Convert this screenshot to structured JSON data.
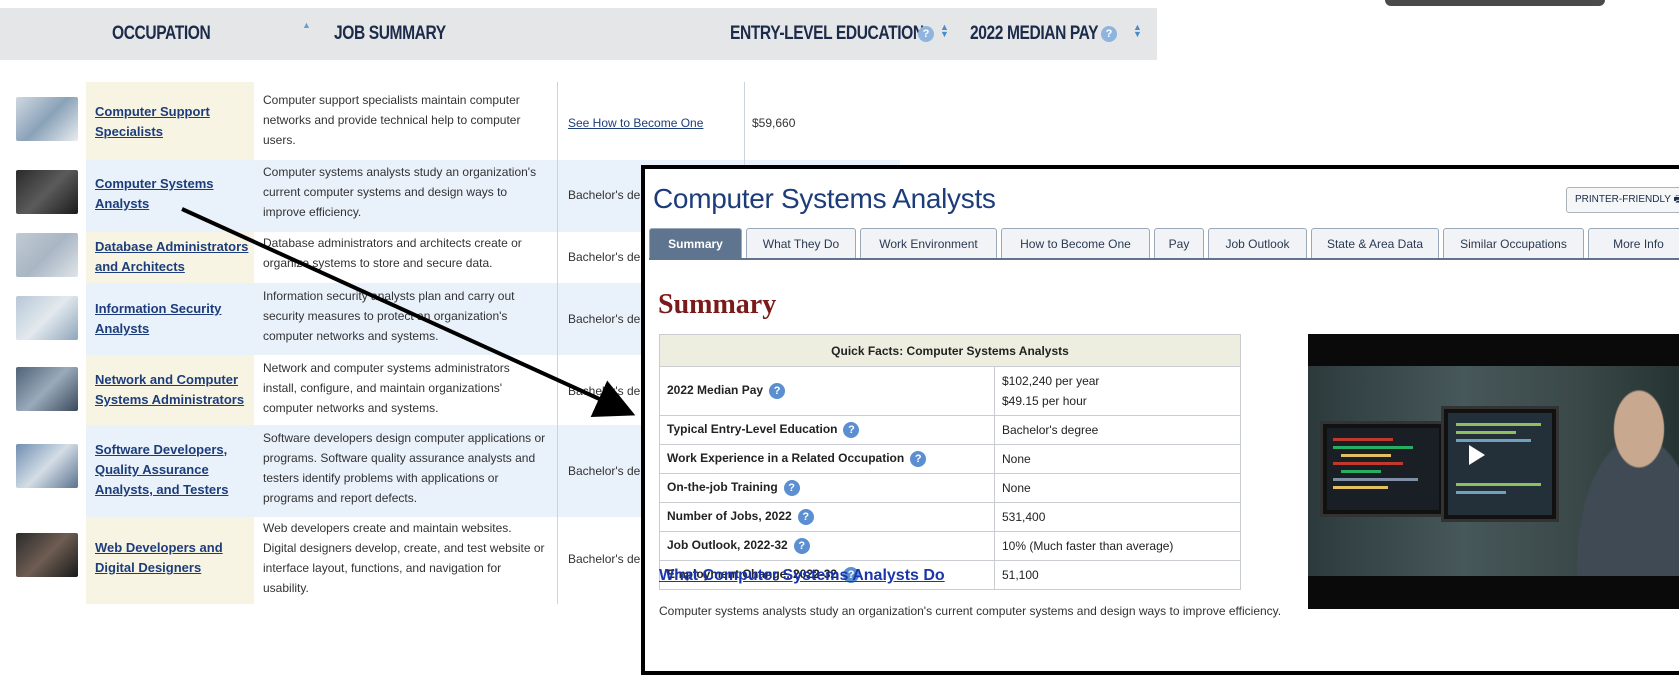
{
  "table": {
    "headers": {
      "occupation": "OCCUPATION",
      "job_summary": "JOB SUMMARY",
      "entry_level_education": "ENTRY-LEVEL EDUCATION",
      "median_pay": "2022 MEDIAN PAY"
    },
    "rows": [
      {
        "occupation": [
          "Computer Support",
          "Specialists"
        ],
        "summary": [
          "Computer support specialists maintain computer",
          "networks and provide technical help to computer",
          "users."
        ],
        "education": "See How to Become One",
        "pay": "$59,660"
      },
      {
        "occupation": [
          "Computer Systems",
          "Analysts"
        ],
        "summary": [
          "Computer systems analysts study an organization's",
          "current computer systems and design ways to",
          "improve efficiency."
        ],
        "education": "Bachelor's de",
        "pay": ""
      },
      {
        "occupation": [
          "Database Administrators",
          "and Architects"
        ],
        "summary": [
          "Database administrators and architects create or",
          "organize systems to store and secure data."
        ],
        "education": "Bachelor's de",
        "pay": ""
      },
      {
        "occupation": [
          "Information Security",
          "Analysts"
        ],
        "summary": [
          "Information security analysts plan and carry out",
          "security measures to protect an organization's",
          "computer networks and systems."
        ],
        "education": "Bachelor's de",
        "pay": ""
      },
      {
        "occupation": [
          "Network and Computer",
          "Systems Administrators"
        ],
        "summary": [
          "Network and computer systems administrators",
          "install, configure, and maintain organizations'",
          "computer networks and systems."
        ],
        "education": "Bachelor's de",
        "pay": ""
      },
      {
        "occupation": [
          "Software Developers,",
          "Quality Assurance",
          "Analysts, and Testers"
        ],
        "summary": [
          "Software developers design computer applications or",
          "programs. Software quality assurance analysts and",
          "testers identify problems with applications or",
          "programs and report defects."
        ],
        "education": "Bachelor's de",
        "pay": ""
      },
      {
        "occupation": [
          "Web Developers and",
          "Digital Designers"
        ],
        "summary": [
          "Web developers create and maintain websites.",
          "Digital designers develop, create, and test website or",
          "interface layout, functions, and navigation for",
          "usability."
        ],
        "education": "Bachelor's de",
        "pay": ""
      }
    ]
  },
  "popup": {
    "title": "Computer Systems Analysts",
    "printer_friendly": "PRINTER-FRIENDLY",
    "tabs": [
      "Summary",
      "What They Do",
      "Work Environment",
      "How to Become One",
      "Pay",
      "Job Outlook",
      "State & Area Data",
      "Similar Occupations",
      "More Info"
    ],
    "active_tab": "Summary",
    "section_heading": "Summary",
    "quick_facts": {
      "title": "Quick Facts: Computer Systems Analysts",
      "rows": [
        {
          "label": "2022 Median Pay",
          "value": [
            "$102,240 per year",
            "$49.15 per hour"
          ]
        },
        {
          "label": "Typical Entry-Level Education",
          "value": [
            "Bachelor's degree"
          ]
        },
        {
          "label": "Work Experience in a Related Occupation",
          "value": [
            "None"
          ]
        },
        {
          "label": "On-the-job Training",
          "value": [
            "None"
          ]
        },
        {
          "label": "Number of Jobs, 2022",
          "value": [
            "531,400"
          ]
        },
        {
          "label": "Job Outlook, 2022-32",
          "value": [
            "10% (Much faster than average)"
          ]
        },
        {
          "label": "Employment Change, 2022-32",
          "value": [
            "51,100"
          ]
        }
      ]
    },
    "what_they_do_link": "What Computer Systems Analysts Do",
    "what_they_do_text": "Computer systems analysts study an organization's current computer systems and design ways to improve efficiency."
  },
  "colors": {
    "link": "#1d3d7a",
    "summary_heading": "#7a1a1a",
    "active_tab": "#5f748f",
    "occupation_cell": "#f7f4e4",
    "row_alt": "#e9f1fb"
  }
}
